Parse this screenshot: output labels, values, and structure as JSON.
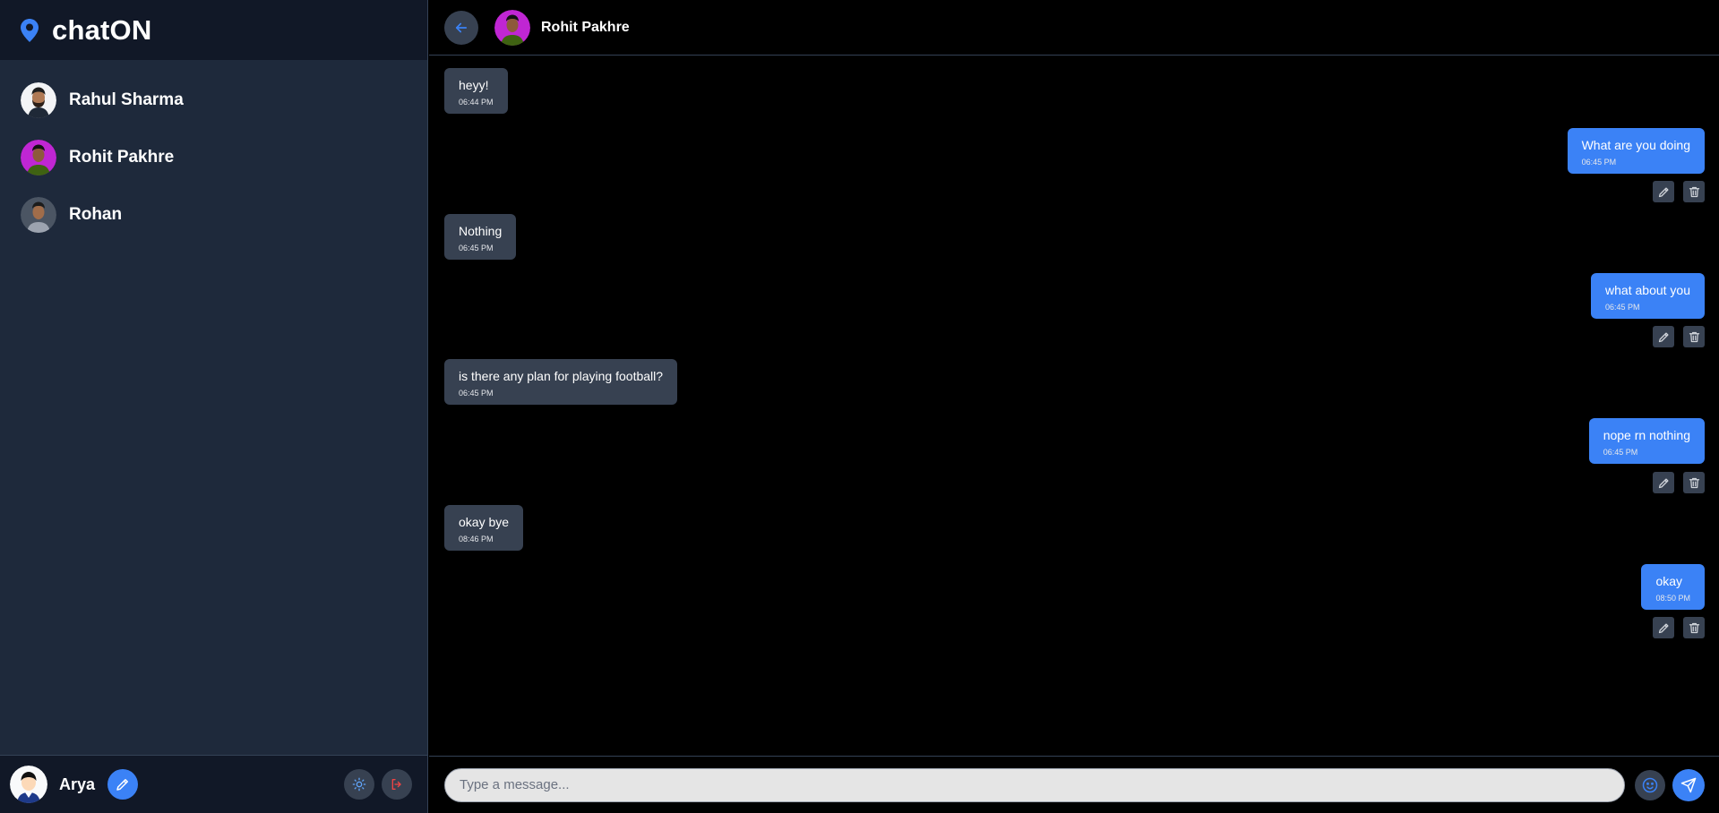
{
  "app": {
    "name": "chatON"
  },
  "contacts": [
    {
      "name": "Rahul Sharma"
    },
    {
      "name": "Rohit Pakhre"
    },
    {
      "name": "Rohan"
    }
  ],
  "current_user": {
    "name": "Arya"
  },
  "chat": {
    "partner_name": "Rohit Pakhre",
    "messages": [
      {
        "direction": "in",
        "text": "heyy!",
        "time": "06:44 PM"
      },
      {
        "direction": "out",
        "text": "What are you doing",
        "time": "06:45 PM"
      },
      {
        "direction": "in",
        "text": "Nothing",
        "time": "06:45 PM"
      },
      {
        "direction": "out",
        "text": "what about you",
        "time": "06:45 PM"
      },
      {
        "direction": "in",
        "text": "is there any plan for playing football?",
        "time": "06:45 PM"
      },
      {
        "direction": "out",
        "text": "nope rn nothing",
        "time": "06:45 PM"
      },
      {
        "direction": "in",
        "text": "okay bye",
        "time": "08:46 PM"
      },
      {
        "direction": "out",
        "text": "okay",
        "time": "08:50 PM"
      }
    ]
  },
  "composer": {
    "placeholder": "Type a message..."
  },
  "colors": {
    "accent": "#3b82f6",
    "sidebar_bg": "#1e293b",
    "header_bg": "#111827",
    "incoming_bubble": "#374151",
    "outgoing_bubble": "#3b82f6",
    "logout": "#ef4444"
  },
  "icons": {
    "brand": "location-pin-icon",
    "edit_profile": "pencil-icon",
    "theme": "sun-icon",
    "logout": "logout-icon",
    "back": "arrow-left-icon",
    "edit_message": "pencil-icon",
    "delete_message": "trash-icon",
    "emoji": "smiley-icon",
    "send": "send-icon"
  }
}
